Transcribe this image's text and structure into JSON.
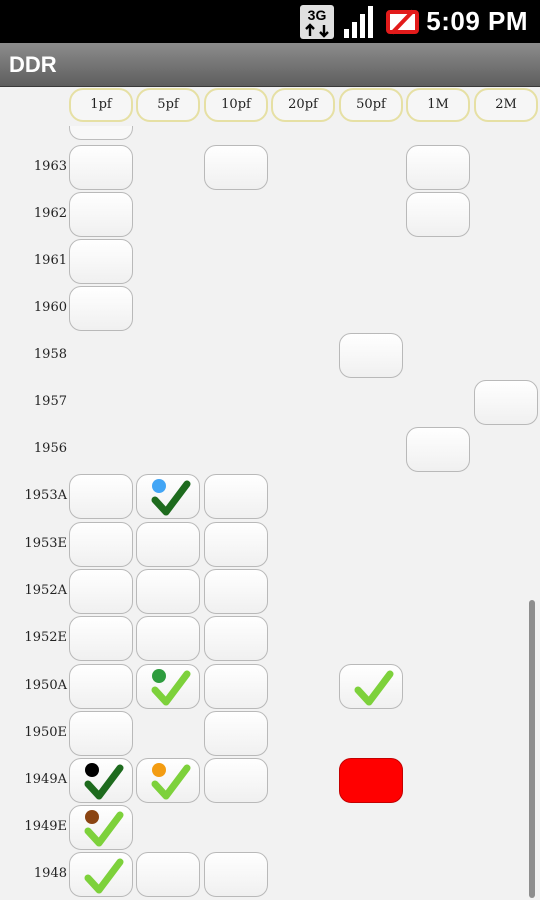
{
  "status_bar": {
    "time": "5:09 PM",
    "network": "3G"
  },
  "app": {
    "title": "DDR"
  },
  "columns": [
    "1pf",
    "5pf",
    "10pf",
    "20pf",
    "50pf",
    "1M",
    "2M"
  ],
  "rows": [
    {
      "label": "1963"
    },
    {
      "label": "1962"
    },
    {
      "label": "1961"
    },
    {
      "label": "1960"
    },
    {
      "label": "1958"
    },
    {
      "label": "1957"
    },
    {
      "label": "1956"
    },
    {
      "label": "1953A"
    },
    {
      "label": "1953E"
    },
    {
      "label": "1952A"
    },
    {
      "label": "1952E"
    },
    {
      "label": "1950A"
    },
    {
      "label": "1950E"
    },
    {
      "label": "1949A"
    },
    {
      "label": "1949E"
    },
    {
      "label": "1948"
    }
  ],
  "cells": [
    {
      "row": "1963",
      "col": "1pf",
      "state": "empty"
    },
    {
      "row": "1963",
      "col": "10pf",
      "state": "empty"
    },
    {
      "row": "1963",
      "col": "1M",
      "state": "empty"
    },
    {
      "row": "1962",
      "col": "1pf",
      "state": "empty"
    },
    {
      "row": "1962",
      "col": "1M",
      "state": "empty"
    },
    {
      "row": "1961",
      "col": "1pf",
      "state": "empty"
    },
    {
      "row": "1960",
      "col": "1pf",
      "state": "empty"
    },
    {
      "row": "1958",
      "col": "50pf",
      "state": "empty"
    },
    {
      "row": "1957",
      "col": "2M",
      "state": "empty"
    },
    {
      "row": "1956",
      "col": "1M",
      "state": "empty"
    },
    {
      "row": "1953A",
      "col": "1pf",
      "state": "empty"
    },
    {
      "row": "1953A",
      "col": "5pf",
      "state": "checked",
      "check_color": "#1e6b1e",
      "dot_color": "#42a5f5"
    },
    {
      "row": "1953A",
      "col": "10pf",
      "state": "empty"
    },
    {
      "row": "1953E",
      "col": "1pf",
      "state": "empty"
    },
    {
      "row": "1953E",
      "col": "5pf",
      "state": "empty"
    },
    {
      "row": "1953E",
      "col": "10pf",
      "state": "empty"
    },
    {
      "row": "1952A",
      "col": "1pf",
      "state": "empty"
    },
    {
      "row": "1952A",
      "col": "5pf",
      "state": "empty"
    },
    {
      "row": "1952A",
      "col": "10pf",
      "state": "empty"
    },
    {
      "row": "1952E",
      "col": "1pf",
      "state": "empty"
    },
    {
      "row": "1952E",
      "col": "5pf",
      "state": "empty"
    },
    {
      "row": "1952E",
      "col": "10pf",
      "state": "empty"
    },
    {
      "row": "1950A",
      "col": "1pf",
      "state": "empty"
    },
    {
      "row": "1950A",
      "col": "5pf",
      "state": "checked",
      "check_color": "#7dd13b",
      "dot_color": "#2e9c3e"
    },
    {
      "row": "1950A",
      "col": "10pf",
      "state": "empty"
    },
    {
      "row": "1950A",
      "col": "50pf",
      "state": "checked",
      "check_color": "#7dd13b"
    },
    {
      "row": "1950E",
      "col": "1pf",
      "state": "empty"
    },
    {
      "row": "1950E",
      "col": "10pf",
      "state": "empty"
    },
    {
      "row": "1949A",
      "col": "1pf",
      "state": "checked",
      "check_color": "#1e6b1e",
      "dot_color": "#000000"
    },
    {
      "row": "1949A",
      "col": "5pf",
      "state": "checked",
      "check_color": "#7dd13b",
      "dot_color": "#f39c12"
    },
    {
      "row": "1949A",
      "col": "10pf",
      "state": "empty"
    },
    {
      "row": "1949A",
      "col": "50pf",
      "state": "red",
      "fill_color": "#ff0000"
    },
    {
      "row": "1949E",
      "col": "1pf",
      "state": "checked",
      "check_color": "#7dd13b",
      "dot_color": "#8b4513"
    },
    {
      "row": "1948",
      "col": "1pf",
      "state": "checked",
      "check_color": "#7dd13b"
    },
    {
      "row": "1948",
      "col": "5pf",
      "state": "empty"
    },
    {
      "row": "1948",
      "col": "10pf",
      "state": "empty"
    }
  ]
}
